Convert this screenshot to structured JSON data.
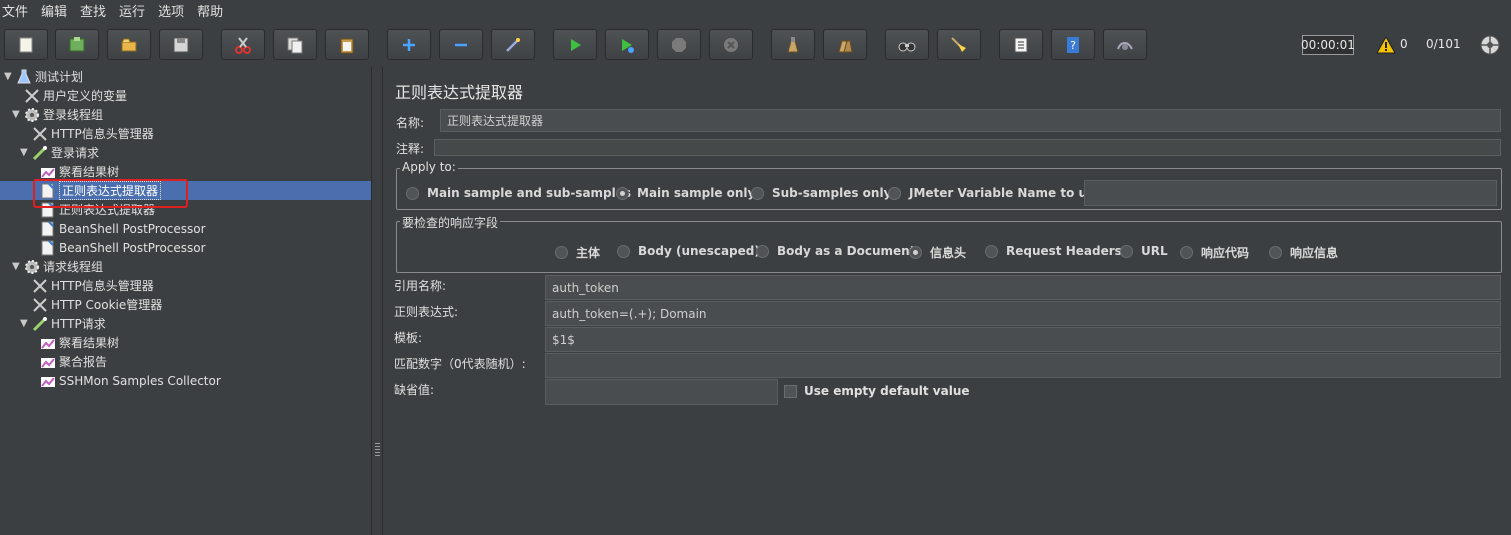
{
  "menu": [
    "文件",
    "编辑",
    "查找",
    "运行",
    "选项",
    "帮助"
  ],
  "toolbar": {
    "buttons": [
      "new-icon",
      "templates-icon",
      "open-icon",
      "save-icon",
      "cut-icon",
      "copy-icon",
      "paste-icon",
      "expand-icon",
      "collapse-icon",
      "toggle-icon",
      "start-icon",
      "start-no-pause-icon",
      "stop-icon",
      "shutdown-icon",
      "clear-icon",
      "clear-all-icon",
      "search-icon",
      "reset-search-icon",
      "function-helper-icon",
      "help-icon",
      "remote-icon"
    ],
    "timer": "00:00:01",
    "warnings": "0",
    "threads": "0/101"
  },
  "tree": [
    {
      "label": "测试计划",
      "icon": "test-plan-icon",
      "toggle": "▼"
    },
    {
      "label": "用户定义的变量",
      "icon": "config-icon"
    },
    {
      "label": "登录线程组",
      "icon": "thread-group-icon",
      "toggle": "▼"
    },
    {
      "label": "HTTP信息头管理器",
      "icon": "config-icon"
    },
    {
      "label": "登录请求",
      "icon": "sampler-icon",
      "toggle": "▼"
    },
    {
      "label": "察看结果树",
      "icon": "listener-icon"
    },
    {
      "label": "正则表达式提取器",
      "icon": "postprocessor-icon",
      "selected": true
    },
    {
      "label": "正则表达式提取器",
      "icon": "postprocessor-icon"
    },
    {
      "label": "BeanShell PostProcessor",
      "icon": "postprocessor-icon"
    },
    {
      "label": "BeanShell PostProcessor",
      "icon": "postprocessor-icon"
    },
    {
      "label": "请求线程组",
      "icon": "thread-group-icon",
      "toggle": "▼"
    },
    {
      "label": "HTTP信息头管理器",
      "icon": "config-icon"
    },
    {
      "label": "HTTP Cookie管理器",
      "icon": "config-icon"
    },
    {
      "label": "HTTP请求",
      "icon": "sampler-icon",
      "toggle": "▼"
    },
    {
      "label": "察看结果树",
      "icon": "listener-icon"
    },
    {
      "label": "聚合报告",
      "icon": "listener-icon"
    },
    {
      "label": "SSHMon Samples Collector",
      "icon": "listener-icon"
    }
  ],
  "panel": {
    "title": "正则表达式提取器",
    "name_label": "名称:",
    "name_value": "正则表达式提取器",
    "comment_label": "注释:",
    "comment_value": "",
    "apply_to": {
      "legend": "Apply to:",
      "options": [
        "Main sample and sub-samples",
        "Main sample only",
        "Sub-samples only",
        "JMeter Variable Name to use"
      ],
      "selected": 1,
      "var_value": ""
    },
    "field_to_check": {
      "legend": "要检查的响应字段",
      "options": [
        "主体",
        "Body (unescaped)",
        "Body as a Document",
        "信息头",
        "Request Headers",
        "URL",
        "响应代码",
        "响应信息"
      ],
      "selected": 3
    },
    "ref_name_label": "引用名称:",
    "ref_name_value": "auth_token",
    "regex_label": "正则表达式:",
    "regex_value": "auth_token=(.+); Domain",
    "template_label": "模板:",
    "template_value": "$1$",
    "match_no_label": "匹配数字（0代表随机）:",
    "match_no_value": "",
    "default_label": "缺省值:",
    "default_value": "",
    "use_empty_label": "Use empty default value"
  }
}
